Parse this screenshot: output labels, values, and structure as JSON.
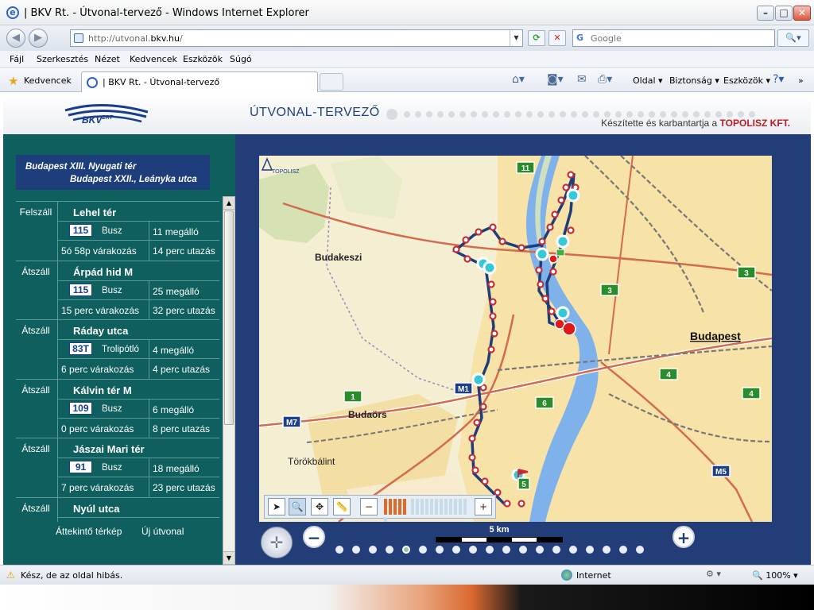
{
  "window": {
    "title": "| BKV Rt. - Útvonal-tervező - Windows Internet Explorer"
  },
  "address": {
    "url_prefix": "http://utvonal.",
    "url_domain": "bkv.hu",
    "url_suffix": "/",
    "search_placeholder": "Google"
  },
  "menu": [
    "Fájl",
    "Szerkesztés",
    "Nézet",
    "Kedvencek",
    "Eszközök",
    "Súgó"
  ],
  "favorites": {
    "label": "Kedvencek",
    "tab_label": "| BKV Rt. - Útvonal-tervező",
    "commands": [
      "Oldal",
      "Biztonság",
      "Eszközök"
    ]
  },
  "header": {
    "logo_text": "BKV",
    "logo_sup": "ZRT",
    "app_title": "ÚTVONAL-TERVEZŐ",
    "credit_prefix": "Készítette és karbantartja a ",
    "credit_brand": "TOPOLISZ KFT."
  },
  "route": {
    "from": "Budapest XIII. Nyugati tér",
    "to": "Budapest XXII., Leányka utca"
  },
  "itinerary": [
    {
      "action": "Felszáll",
      "stop": "Lehel tér",
      "line": "115",
      "vehicle": "Busz",
      "stops": "11 megálló",
      "wait": "5ó 58p várakozás",
      "travel": "14 perc utazás"
    },
    {
      "action": "Átszáll",
      "stop": "Árpád hid M",
      "line": "115",
      "vehicle": "Busz",
      "stops": "25 megálló",
      "wait": "15 perc várakozás",
      "travel": "32 perc utazás"
    },
    {
      "action": "Átszáll",
      "stop": "Ráday utca",
      "line": "83T",
      "vehicle": "Trolipótló",
      "stops": "4 megálló",
      "wait": "6 perc várakozás",
      "travel": "4 perc utazás"
    },
    {
      "action": "Átszáll",
      "stop": "Kálvin tér M",
      "line": "109",
      "vehicle": "Busz",
      "stops": "6 megálló",
      "wait": "0 perc várakozás",
      "travel": "8 perc utazás"
    },
    {
      "action": "Átszáll",
      "stop": "Jászai Mari tér",
      "line": "91",
      "vehicle": "Busz",
      "stops": "18 megálló",
      "wait": "7 perc várakozás",
      "travel": "23 perc utazás"
    },
    {
      "action": "Átszáll",
      "stop": "Nyúl utca",
      "line": "",
      "vehicle": "",
      "stops": "",
      "wait": "",
      "travel": ""
    }
  ],
  "left_links": {
    "overview": "Áttekintő térkép",
    "new_route": "Új útvonal"
  },
  "map": {
    "labels": {
      "budakeszi": "Budakeszi",
      "budaors": "Budaörs",
      "torokbalint": "Törökbálint",
      "budapest": "Budapest",
      "topolisz": "TOPOLISZ"
    },
    "road_numbers": [
      "11",
      "3",
      "3",
      "4",
      "4",
      "1",
      "6",
      "5"
    ],
    "motorways": [
      "M7",
      "M1",
      "M5"
    ],
    "scale_label": "5 km"
  },
  "statusbar": {
    "text": "Kész, de az oldal hibás.",
    "zone": "Internet",
    "zoom": "100%"
  },
  "colors": {
    "panel_teal": "#0e5f5d",
    "route_navy": "#1d3e7a",
    "map_frame": "#233d78",
    "brand_red": "#c21821"
  }
}
